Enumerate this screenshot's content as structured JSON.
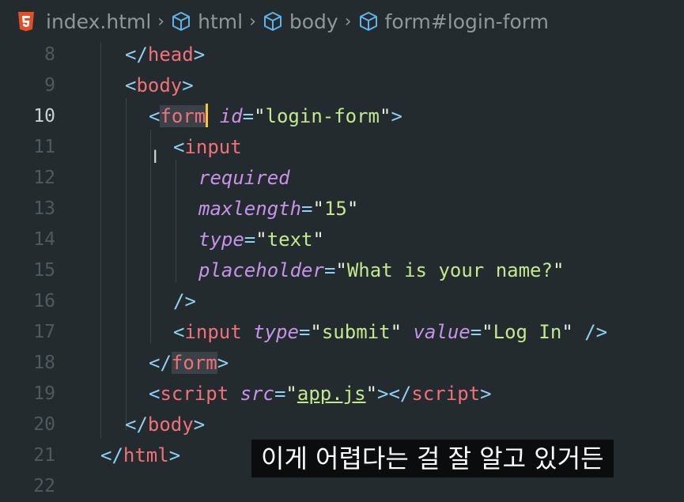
{
  "breadcrumb": {
    "file": "index.html",
    "items": [
      "html",
      "body",
      "form#login-form"
    ]
  },
  "lines": [
    {
      "n": "8"
    },
    {
      "n": "9"
    },
    {
      "n": "10"
    },
    {
      "n": "11"
    },
    {
      "n": "12"
    },
    {
      "n": "13"
    },
    {
      "n": "14"
    },
    {
      "n": "15"
    },
    {
      "n": "16"
    },
    {
      "n": "17"
    },
    {
      "n": "18"
    },
    {
      "n": "19"
    },
    {
      "n": "20"
    },
    {
      "n": "21"
    },
    {
      "n": "22"
    }
  ],
  "code": {
    "l8_tag": "head",
    "l9_tag": "body",
    "l10_tag": "form",
    "l10_attr": "id",
    "l10_val": "login-form",
    "l11_tag": "input",
    "l12_attr": "required",
    "l13_attr": "maxlength",
    "l13_val": "15",
    "l14_attr": "type",
    "l14_val": "text",
    "l15_attr": "placeholder",
    "l15_val": "What is your name?",
    "l17_tag": "input",
    "l17_attr1": "type",
    "l17_val1": "submit",
    "l17_attr2": "value",
    "l17_val2": "Log In",
    "l18_tag": "form",
    "l19_tag": "script",
    "l19_attr": "src",
    "l19_val": "app.js",
    "l19_close": "script",
    "l20_tag": "body",
    "l21_tag": "html"
  },
  "caption": "이게 어렵다는 걸 잘 알고 있거든",
  "colors": {
    "background": "#232b2f",
    "tag": "#f07178",
    "attribute": "#c792ea",
    "string": "#c3e88d",
    "punctuation": "#8fd0f5",
    "cursor": "#f5c242"
  }
}
